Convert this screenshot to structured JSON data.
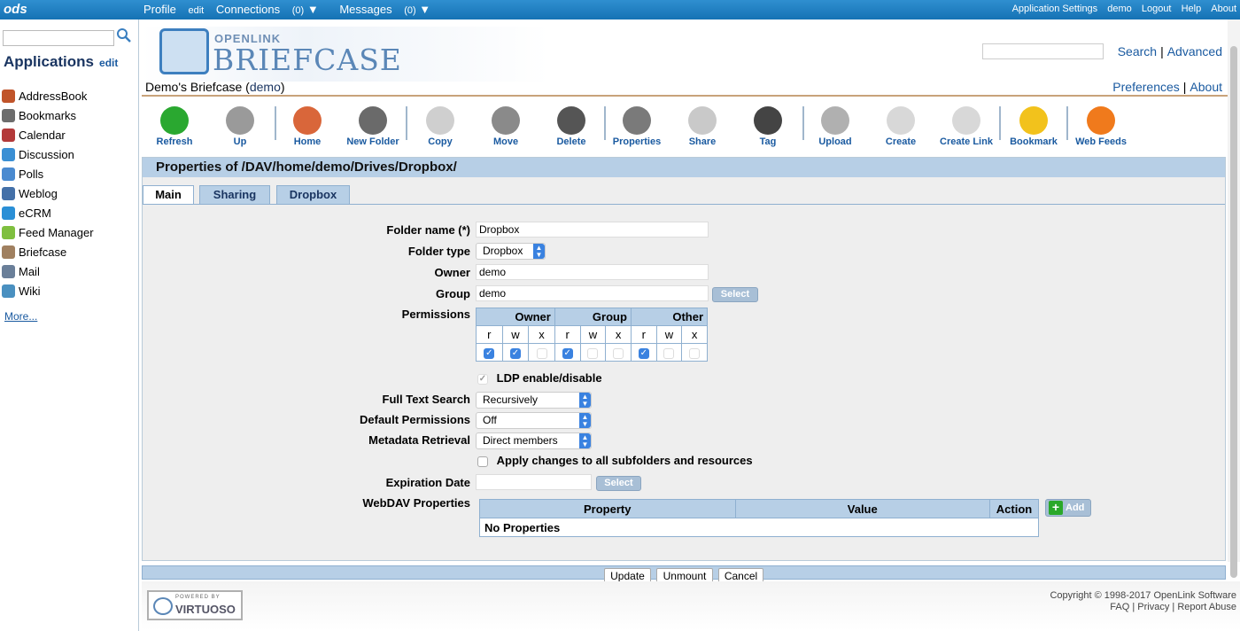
{
  "topbar": {
    "logo": "ods",
    "profile": "Profile",
    "profile_edit": "edit",
    "connections": "Connections",
    "connections_count": "(0)",
    "messages": "Messages",
    "messages_count": "(0)",
    "app_settings": "Application Settings",
    "user": "demo",
    "logout": "Logout",
    "help": "Help",
    "about": "About"
  },
  "sidebar": {
    "title": "Applications",
    "edit": "edit",
    "items": [
      {
        "label": "AddressBook",
        "color": "#c0542a"
      },
      {
        "label": "Bookmarks",
        "color": "#6d6d6d"
      },
      {
        "label": "Calendar",
        "color": "#b33a3a"
      },
      {
        "label": "Discussion",
        "color": "#3a8fd4"
      },
      {
        "label": "Polls",
        "color": "#4a8ad0"
      },
      {
        "label": "Weblog",
        "color": "#4470a8"
      },
      {
        "label": "eCRM",
        "color": "#2a8fd6"
      },
      {
        "label": "Feed Manager",
        "color": "#7fbf3f"
      },
      {
        "label": "Briefcase",
        "color": "#a08060"
      },
      {
        "label": "Mail",
        "color": "#6a7f99"
      },
      {
        "label": "Wiki",
        "color": "#4a90c0"
      }
    ],
    "more": "More..."
  },
  "header": {
    "brand_small": "OPENLINK",
    "brand_big": "BRIEFCASE",
    "search": "Search",
    "advanced": "Advanced",
    "title_prefix": "Demo's Briefcase (",
    "title_user": "demo",
    "title_suffix": ")",
    "preferences": "Preferences",
    "about": "About"
  },
  "toolbar": [
    {
      "label": "Refresh",
      "color": "#2aa830"
    },
    {
      "label": "Up",
      "color": "#9a9a9a"
    },
    {
      "label": "Home",
      "color": "#d9663a"
    },
    {
      "label": "New Folder",
      "color": "#6a6a6a"
    },
    {
      "label": "Copy",
      "color": "#cfcfcf"
    },
    {
      "label": "Move",
      "color": "#8a8a8a"
    },
    {
      "label": "Delete",
      "color": "#555555"
    },
    {
      "label": "Properties",
      "color": "#7a7a7a"
    },
    {
      "label": "Share",
      "color": "#c9c9c9"
    },
    {
      "label": "Tag",
      "color": "#444444"
    },
    {
      "label": "Upload",
      "color": "#b0b0b0"
    },
    {
      "label": "Create",
      "color": "#d8d8d8"
    },
    {
      "label": "Create Link",
      "color": "#d8d8d8"
    },
    {
      "label": "Bookmark",
      "color": "#f2c21c"
    },
    {
      "label": "Web Feeds",
      "color": "#f07a1c"
    }
  ],
  "panel": {
    "heading": "Properties of /DAV/home/demo/Drives/Dropbox/",
    "tabs": [
      "Main",
      "Sharing",
      "Dropbox"
    ],
    "folder_name_label": "Folder name (*)",
    "folder_name_value": "Dropbox",
    "folder_type_label": "Folder type",
    "folder_type_value": "Dropbox",
    "owner_label": "Owner",
    "owner_value": "demo",
    "group_label": "Group",
    "group_value": "demo",
    "select_label": "Select",
    "permissions_label": "Permissions",
    "perm_groups": [
      "Owner",
      "Group",
      "Other"
    ],
    "perm_cols": [
      "r",
      "w",
      "x",
      "r",
      "w",
      "x",
      "r",
      "w",
      "x"
    ],
    "perm_checked": [
      true,
      true,
      false,
      true,
      false,
      false,
      true,
      false,
      false
    ],
    "ldp_label": "LDP enable/disable",
    "fts_label": "Full Text Search",
    "fts_value": "Recursively",
    "defperm_label": "Default Permissions",
    "defperm_value": "Off",
    "meta_label": "Metadata Retrieval",
    "meta_value": "Direct members",
    "apply_label": "Apply changes to all subfolders and resources",
    "expiration_label": "Expiration Date",
    "expiration_value": "",
    "webdav_label": "WebDAV Properties",
    "prop_headers": [
      "Property",
      "Value",
      "Action"
    ],
    "no_props": "No Properties",
    "add_label": "Add"
  },
  "buttons": {
    "update": "Update",
    "unmount": "Unmount",
    "cancel": "Cancel"
  },
  "footer": {
    "powered": "POWERED BY",
    "virtuoso": "VIRTUOSO",
    "copyright": "Copyright © 1998-2017 OpenLink Software",
    "faq": "FAQ",
    "privacy": "Privacy",
    "report": "Report Abuse"
  }
}
